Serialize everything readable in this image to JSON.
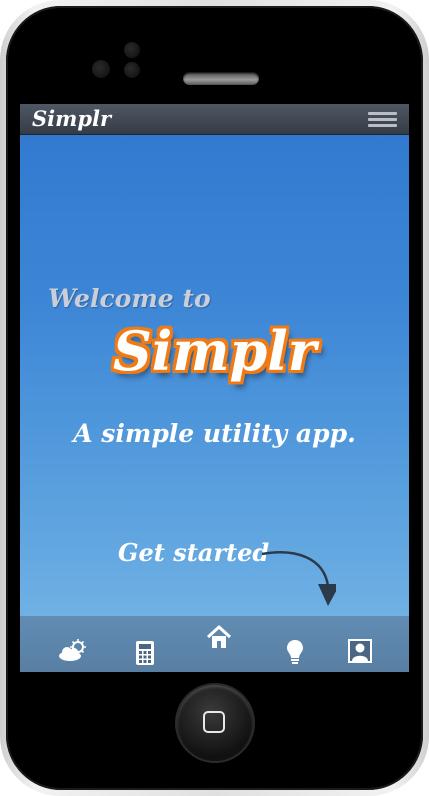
{
  "app": {
    "brand": "Simplr",
    "menu_icon": "hamburger-menu-icon"
  },
  "hero": {
    "welcome": "Welcome to",
    "title": "Simplr",
    "tagline": "A simple utility app.",
    "cta": "Get started"
  },
  "tabs": [
    {
      "icon": "weather-icon"
    },
    {
      "icon": "calculator-icon"
    },
    {
      "icon": "home-icon"
    },
    {
      "icon": "lightbulb-icon"
    },
    {
      "icon": "contact-icon"
    }
  ],
  "colors": {
    "topbar": "#3f4650",
    "screen_top": "#2f78cf",
    "screen_bottom": "#7bb8e8",
    "hero_outline": "#f07b14",
    "welcome_text": "#c9ced8"
  }
}
